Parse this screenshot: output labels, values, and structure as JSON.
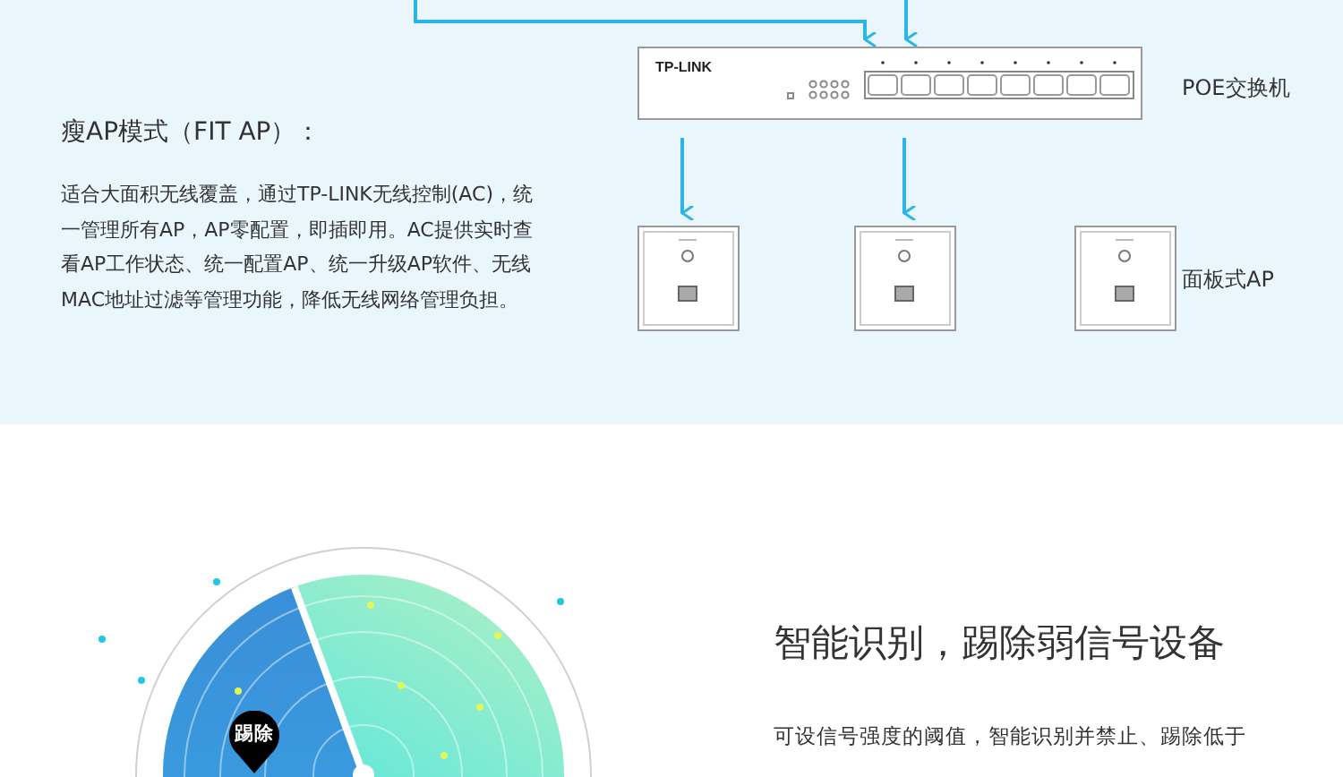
{
  "fit_ap_section": {
    "title": "瘦AP模式（FIT AP）：",
    "description": "适合大面积无线覆盖，通过TP-LINK无线控制(AC)，统一管理所有AP，AP零配置，即插即用。AC提供实时查看AP工作状态、统一配置AP、统一升级AP软件、无线MAC地址过滤等管理功能，降低无线网络管理负担。",
    "diagram": {
      "switch_brand": "TP-LINK",
      "switch_label": "POE交换机",
      "ap_label": "面板式AP"
    }
  },
  "smart_section": {
    "radar_pin": "踢除",
    "heading": "智能识别，踢除弱信号设备",
    "description": "可设信号强度的阈值，智能识别并禁止、踢除低于"
  }
}
